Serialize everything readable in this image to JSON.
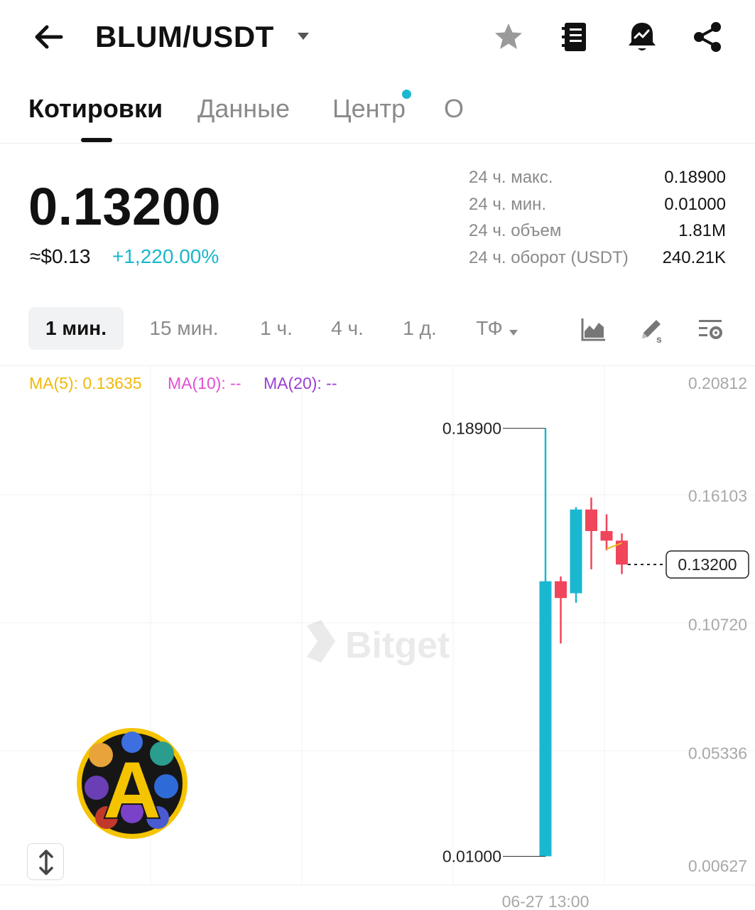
{
  "header": {
    "pair": "BLUM/USDT"
  },
  "tabs": [
    {
      "label": "Котировки",
      "active": true
    },
    {
      "label": "Данные",
      "active": false
    },
    {
      "label": "Центр",
      "active": false,
      "has_dot": true
    },
    {
      "label": "О",
      "active": false
    }
  ],
  "price": {
    "last": "0.13200",
    "usd": "≈$0.13",
    "change": "+1,220.00%"
  },
  "stats": [
    {
      "label": "24 ч. макс.",
      "value": "0.18900"
    },
    {
      "label": "24 ч. мин.",
      "value": "0.01000"
    },
    {
      "label": "24 ч. объем",
      "value": "1.81M"
    },
    {
      "label": "24 ч. оборот (USDT)",
      "value": "240.21K"
    }
  ],
  "timeframes": [
    {
      "label": "1 мин.",
      "active": true
    },
    {
      "label": "15 мин.",
      "active": false
    },
    {
      "label": "1 ч.",
      "active": false
    },
    {
      "label": "4 ч.",
      "active": false
    },
    {
      "label": "1 д.",
      "active": false
    },
    {
      "label": "ТФ",
      "active": false
    }
  ],
  "ma": [
    {
      "label": "MA(5): 0.13635",
      "color": "#f0b90b"
    },
    {
      "label": "MA(10): --",
      "color": "#e44fd1"
    },
    {
      "label": "MA(20): --",
      "color": "#9b3fd6"
    }
  ],
  "watermark": "Bitget",
  "logo_letter": "A",
  "colors": {
    "up": "#1ab7d1",
    "down": "#f0455a",
    "accent": "#1ab7d1"
  },
  "chart_data": {
    "type": "candlestick",
    "y_ticks": [
      "0.20812",
      "0.16103",
      "0.10720",
      "0.05336",
      "0.00627"
    ],
    "ylim": [
      0.00627,
      0.20812
    ],
    "x_ticks": [
      "06-27 13:00"
    ],
    "high_label": "0.18900",
    "low_label": "0.01000",
    "last_price_label": "0.13200",
    "candles": [
      {
        "open": 0.01,
        "high": 0.189,
        "low": 0.01,
        "close": 0.125
      },
      {
        "open": 0.125,
        "high": 0.127,
        "low": 0.099,
        "close": 0.118
      },
      {
        "open": 0.12,
        "high": 0.156,
        "low": 0.116,
        "close": 0.155
      },
      {
        "open": 0.155,
        "high": 0.16,
        "low": 0.13,
        "close": 0.146
      },
      {
        "open": 0.146,
        "high": 0.153,
        "low": 0.138,
        "close": 0.142
      },
      {
        "open": 0.142,
        "high": 0.145,
        "low": 0.128,
        "close": 0.132
      }
    ],
    "ma5_line": [
      0.1385,
      0.141
    ],
    "grid": true
  }
}
